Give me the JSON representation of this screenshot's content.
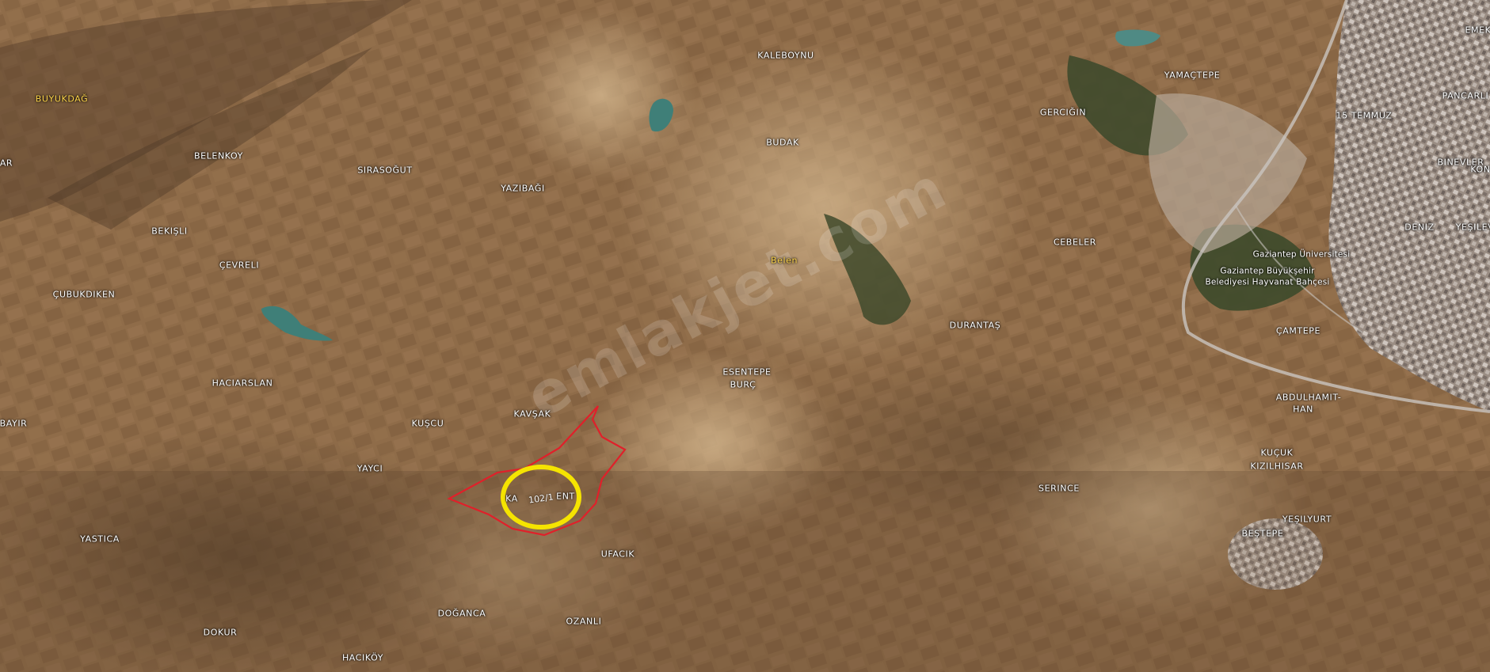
{
  "map": {
    "watermark": "emlakjet.com",
    "parcel_number": "102/1",
    "colors": {
      "parcel_outline": "#e0202a",
      "highlight_circle": "#f5e400",
      "label_text": "#ffffff",
      "district_label": "#ffd54a",
      "terrain_base": "#8c6b49",
      "water": "#3f7f78",
      "forest": "#3f4a2c"
    },
    "labels": {
      "buyukdag": "BUYUKDAĞ",
      "kaleboynu": "KALEBOYNU",
      "yamactepe": "YAMAÇTEPE",
      "emek": "EMEK",
      "pancarli": "PANCARLI",
      "gercigin": "GERCIĞIN",
      "temmuz15": "15 TEMMUZ",
      "budak": "BUDAK",
      "sirasogut": "SIRASOĞUT",
      "yazibagi": "YAZIBAĞI",
      "belenkoy": "BELENKOY",
      "binevler": "BINEVLER",
      "kon": "KON",
      "bekisli": "BEKIŞLI",
      "deniz": "DENIZ",
      "yesilevler": "YEŞILEV",
      "cebeler": "CEBELER",
      "belen": "Belen",
      "cevreli": "ÇEVRELI",
      "gaziantep_univ": "Gaziantep Üniversitesi",
      "zoo_line1": "Gaziantep Büyükşehir",
      "zoo_line2": "Belediyesi Hayvanat Bahçesi",
      "cubukdiken": "ÇUBUKDIKEN",
      "durantas": "DURANTAŞ",
      "camtepe": "ÇAMTEPE",
      "haciarslan": "HACIARSLAN",
      "esentepe": "ESENTEPE",
      "burc": "BURÇ",
      "abdulhamit": "ABDULHAMIT-",
      "han": "HAN",
      "bayir": "BAYIR",
      "kuscu": "KUŞCU",
      "kavsak": "KAVŞAK",
      "kucuk": "KUÇUK",
      "kizilhisar": "KIZILHISAR",
      "yayci": "YAYCI",
      "kalkent_a": "KA",
      "kalkent_b": "ENT",
      "serince": "SERINCE",
      "yesilyurt": "YEŞILYURT",
      "bestepe": "BEŞTEPE",
      "yastica": "YASTICA",
      "ufacik": "UFACIK",
      "doganca": "DOĞANCA",
      "ozanli": "OZANLI",
      "dokur": "DOKUR",
      "hacikoy": "HACIKÖY",
      "ar": "AR"
    }
  }
}
